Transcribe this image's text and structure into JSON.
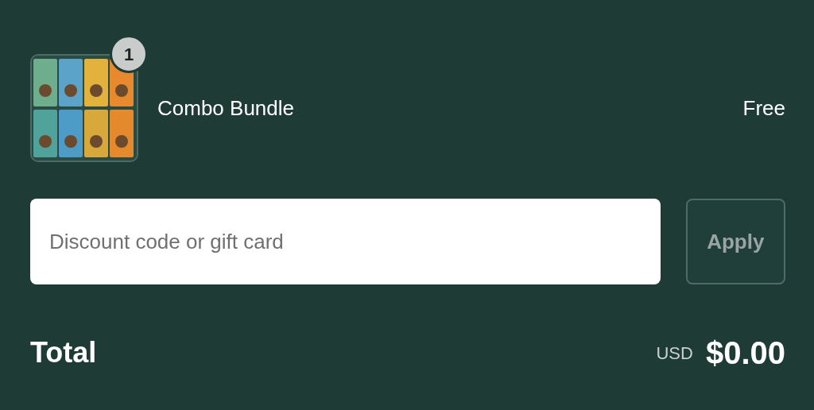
{
  "line_item": {
    "kind": "picture",
    "quantity": "1",
    "name": "Combo Bundle",
    "price": "Free"
  },
  "discount": {
    "placeholder": "Discount code or gift card",
    "apply_button": "Apply",
    "disabled": true
  },
  "total": {
    "label": "Total",
    "currency": "USD",
    "amount": "$0.00"
  }
}
